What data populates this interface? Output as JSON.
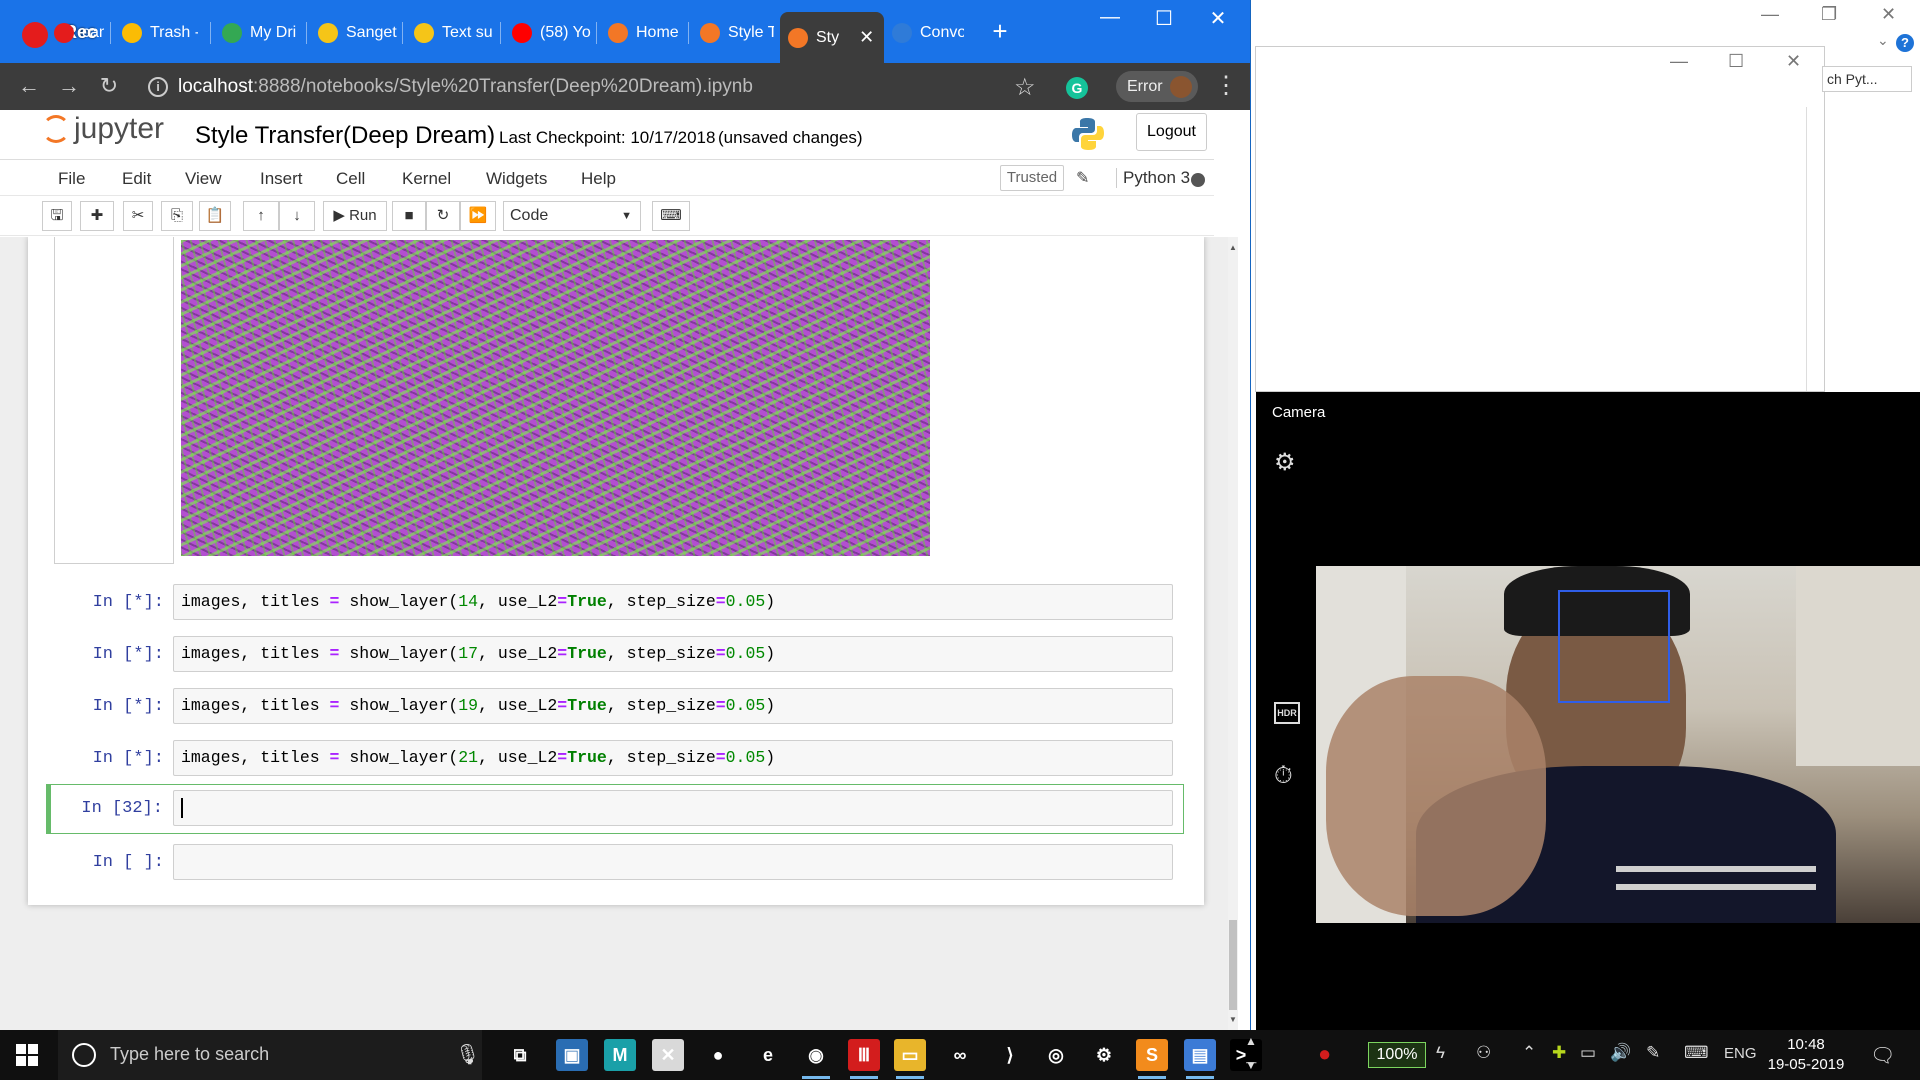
{
  "recorder": {
    "label": "Rec"
  },
  "browser": {
    "tabs": [
      {
        "label": "camera",
        "favicon_color": "#e41c1c"
      },
      {
        "label": "Trash -",
        "favicon_color": "#fbbc04"
      },
      {
        "label": "My Dri",
        "favicon_color": "#34a853"
      },
      {
        "label": "Sanget",
        "favicon_color": "#f5c518"
      },
      {
        "label": "Text su",
        "favicon_color": "#f5c518"
      },
      {
        "label": "(58) Yo",
        "favicon_color": "#ff0000"
      },
      {
        "label": "Home",
        "favicon_color": "#f37726"
      },
      {
        "label": "Style T",
        "favicon_color": "#f37726"
      },
      {
        "label": "Sty",
        "favicon_color": "#f37726",
        "active": true
      },
      {
        "label": "Convo",
        "favicon_color": "#2f7bd8"
      }
    ],
    "new_tab_label": "+",
    "url_host": "localhost",
    "url_path": ":8888/notebooks/Style%20Transfer(Deep%20Dream).ipynb",
    "profile_chip_label": "Error",
    "grammarly_label": "G"
  },
  "jupyter": {
    "logo_text": "jupyter",
    "notebook_title": "Style Transfer(Deep Dream)",
    "checkpoint": "Last Checkpoint: 10/17/2018",
    "unsaved": "(unsaved changes)",
    "logout_label": "Logout",
    "menu": [
      "File",
      "Edit",
      "View",
      "Insert",
      "Cell",
      "Kernel",
      "Widgets",
      "Help"
    ],
    "trusted_label": "Trusted",
    "kernel_name": "Python 3",
    "run_label": "Run",
    "cell_type": "Code",
    "cells": [
      {
        "prompt": "In [*]:",
        "tokens": [
          {
            "t": "images, titles ",
            "c": ""
          },
          {
            "t": "=",
            "c": "op"
          },
          {
            "t": " show_layer(",
            "c": ""
          },
          {
            "t": "14",
            "c": "num"
          },
          {
            "t": ", use_L2",
            "c": ""
          },
          {
            "t": "=",
            "c": "op"
          },
          {
            "t": "True",
            "c": "kw"
          },
          {
            "t": ", step_size",
            "c": ""
          },
          {
            "t": "=",
            "c": "op"
          },
          {
            "t": "0.05",
            "c": "num"
          },
          {
            "t": ")",
            "c": ""
          }
        ]
      },
      {
        "prompt": "In [*]:",
        "tokens": [
          {
            "t": "images, titles ",
            "c": ""
          },
          {
            "t": "=",
            "c": "op"
          },
          {
            "t": " show_layer(",
            "c": ""
          },
          {
            "t": "17",
            "c": "num"
          },
          {
            "t": ", use_L2",
            "c": ""
          },
          {
            "t": "=",
            "c": "op"
          },
          {
            "t": "True",
            "c": "kw"
          },
          {
            "t": ", step_size",
            "c": ""
          },
          {
            "t": "=",
            "c": "op"
          },
          {
            "t": "0.05",
            "c": "num"
          },
          {
            "t": ")",
            "c": ""
          }
        ]
      },
      {
        "prompt": "In [*]:",
        "tokens": [
          {
            "t": "images, titles ",
            "c": ""
          },
          {
            "t": "=",
            "c": "op"
          },
          {
            "t": " show_layer(",
            "c": ""
          },
          {
            "t": "19",
            "c": "num"
          },
          {
            "t": ", use_L2",
            "c": ""
          },
          {
            "t": "=",
            "c": "op"
          },
          {
            "t": "True",
            "c": "kw"
          },
          {
            "t": ", step_size",
            "c": ""
          },
          {
            "t": "=",
            "c": "op"
          },
          {
            "t": "0.05",
            "c": "num"
          },
          {
            "t": ")",
            "c": ""
          }
        ]
      },
      {
        "prompt": "In [*]:",
        "tokens": [
          {
            "t": "images, titles ",
            "c": ""
          },
          {
            "t": "=",
            "c": "op"
          },
          {
            "t": " show_layer(",
            "c": ""
          },
          {
            "t": "21",
            "c": "num"
          },
          {
            "t": ", use_L2",
            "c": ""
          },
          {
            "t": "=",
            "c": "op"
          },
          {
            "t": "True",
            "c": "kw"
          },
          {
            "t": ", step_size",
            "c": ""
          },
          {
            "t": "=",
            "c": "op"
          },
          {
            "t": "0.05",
            "c": "num"
          },
          {
            "t": ")",
            "c": ""
          }
        ]
      },
      {
        "prompt": "In [32]:",
        "tokens": [],
        "selected": true
      },
      {
        "prompt": "In [ ]:",
        "tokens": []
      }
    ]
  },
  "background_window": {
    "search_placeholder": "ch Pyt...",
    "help_label": "?"
  },
  "camera": {
    "title": "Camera",
    "hdr_label": "HDR"
  },
  "taskbar": {
    "search_placeholder": "Type here to search",
    "battery_percent": "100%",
    "language": "ENG",
    "time": "10:48",
    "date": "19-05-2019",
    "apps": [
      {
        "name": "task-view",
        "glyph": "⧉",
        "bg": "#101010"
      },
      {
        "name": "photos",
        "glyph": "▣",
        "bg": "#2a6db3"
      },
      {
        "name": "maya",
        "glyph": "M",
        "bg": "#1aa0a8"
      },
      {
        "name": "blender-tool",
        "glyph": "✕",
        "bg": "#d9d9d9"
      },
      {
        "name": "redapp",
        "glyph": "●",
        "bg": "#101010"
      },
      {
        "name": "edge",
        "glyph": "e",
        "bg": "#101010"
      },
      {
        "name": "chrome",
        "glyph": "◉",
        "bg": "#101010"
      },
      {
        "name": "red-bars",
        "glyph": "Ⅲ",
        "bg": "#d31d1d"
      },
      {
        "name": "file-explorer",
        "glyph": "▭",
        "bg": "#e8b52b"
      },
      {
        "name": "visual-studio",
        "glyph": "∞",
        "bg": "#101010"
      },
      {
        "name": "vscode",
        "glyph": "⟩",
        "bg": "#101010"
      },
      {
        "name": "xbox",
        "glyph": "◎",
        "bg": "#101010"
      },
      {
        "name": "steam",
        "glyph": "⚙",
        "bg": "#101010"
      },
      {
        "name": "sublime",
        "glyph": "S",
        "bg": "#f28b1c"
      },
      {
        "name": "monitor",
        "glyph": "▤",
        "bg": "#3c7bd6"
      },
      {
        "name": "terminal",
        "glyph": ">_",
        "bg": "#000000"
      }
    ]
  }
}
